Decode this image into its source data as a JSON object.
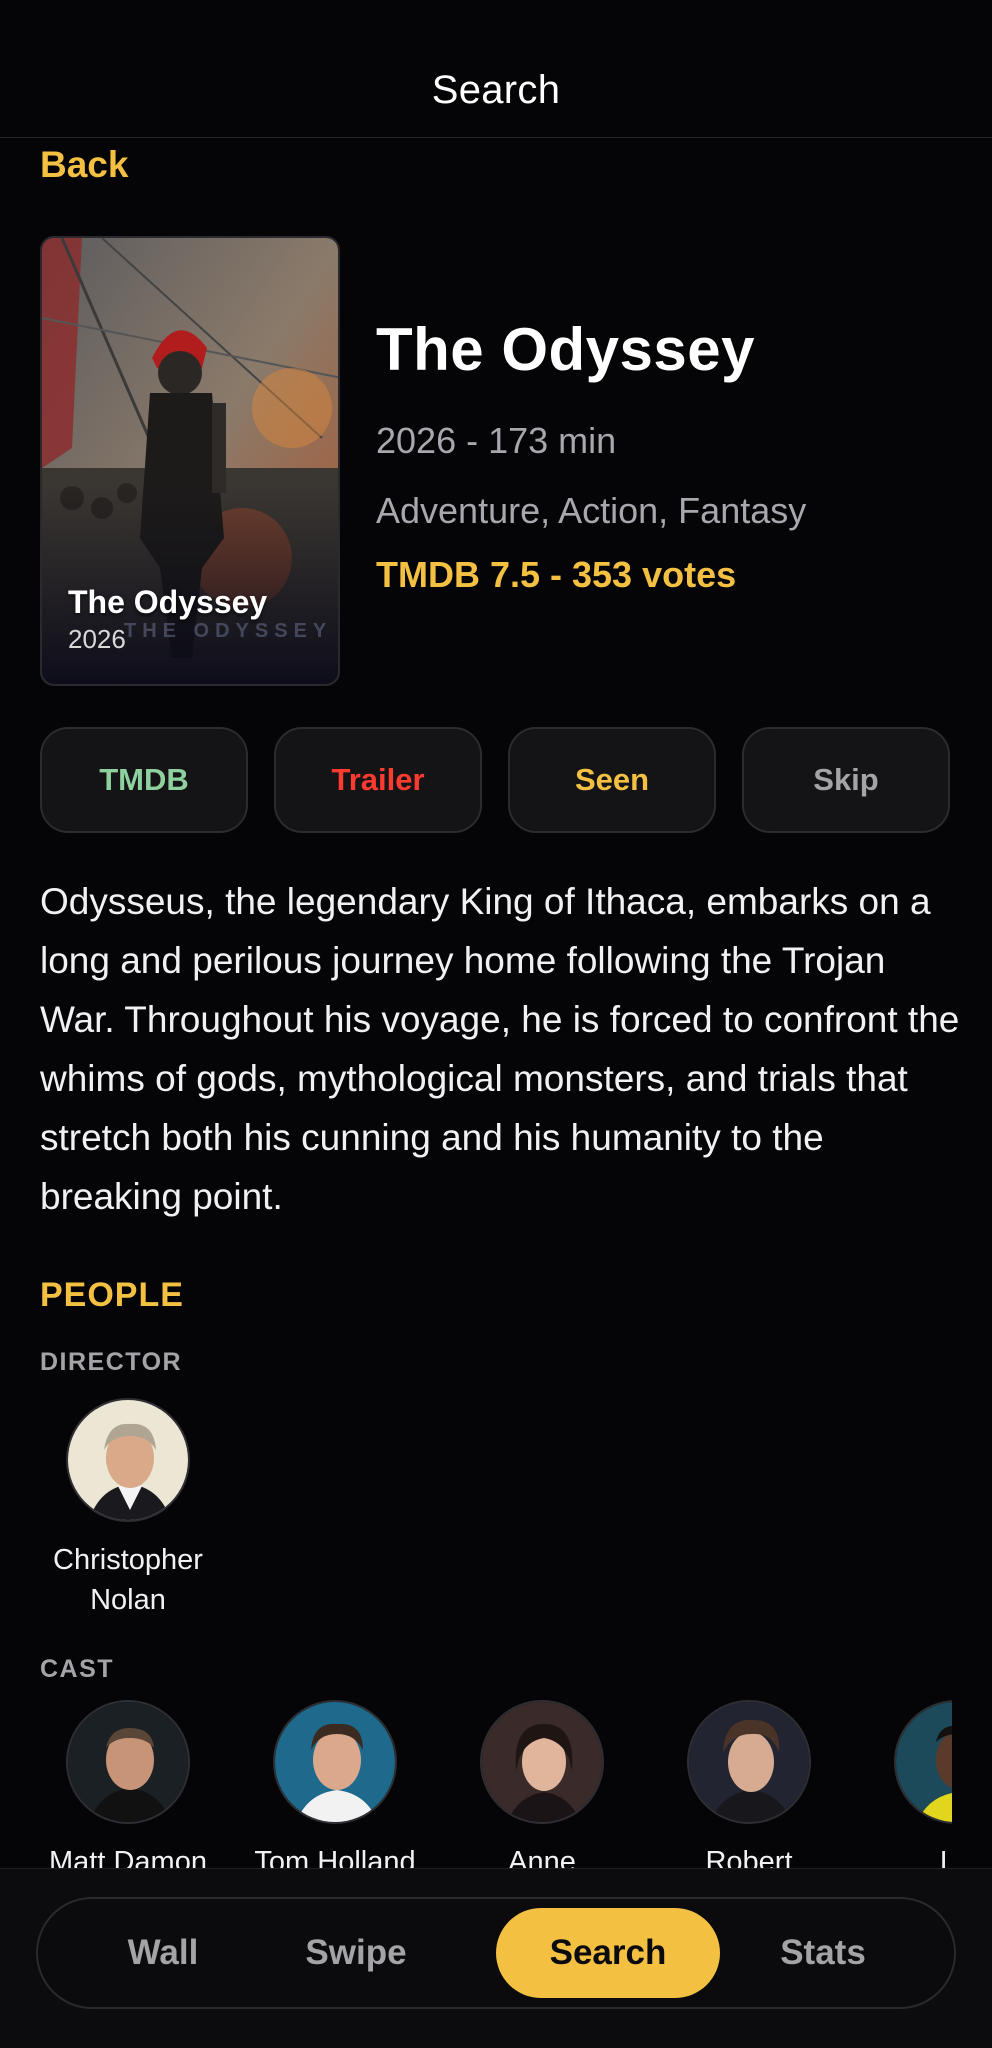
{
  "header": {
    "title": "Search"
  },
  "nav": {
    "back_label": "Back"
  },
  "movie": {
    "poster_title": "The Odyssey",
    "poster_year": "2026",
    "poster_watermark": "THE ODYSSEY",
    "title": "The Odyssey",
    "meta": "2026 - 173 min",
    "genres": "Adventure, Action, Fantasy",
    "rating": "TMDB 7.5 - 353 votes",
    "overview": "Odysseus, the legendary King of Ithaca, embarks on a long and perilous journey home following the Trojan War. Throughout his voyage, he is forced to confront the whims of gods, mythological monsters, and trials that stretch both his cunning and his humanity to the breaking point."
  },
  "actions": {
    "tmdb": {
      "label": "TMDB",
      "color": "#8fd19e"
    },
    "trailer": {
      "label": "Trailer",
      "color": "#ff3b30"
    },
    "seen": {
      "label": "Seen",
      "color": "#f3c042"
    },
    "skip": {
      "label": "Skip",
      "color": "#a4a4a8"
    }
  },
  "people": {
    "section_label": "PEOPLE",
    "director_label": "DIRECTOR",
    "cast_label": "CAST",
    "director": {
      "name": "Christopher Nolan"
    },
    "cast": [
      {
        "name": "Matt Damon"
      },
      {
        "name": "Tom Holland"
      },
      {
        "name": "Anne"
      },
      {
        "name": "Robert"
      },
      {
        "name": "Lu"
      }
    ]
  },
  "tabs": [
    {
      "label": "Wall",
      "active": false
    },
    {
      "label": "Swipe",
      "active": false
    },
    {
      "label": "Search",
      "active": true
    },
    {
      "label": "Stats",
      "active": false
    }
  ],
  "colors": {
    "accent": "#f3c042",
    "background": "#050507"
  }
}
